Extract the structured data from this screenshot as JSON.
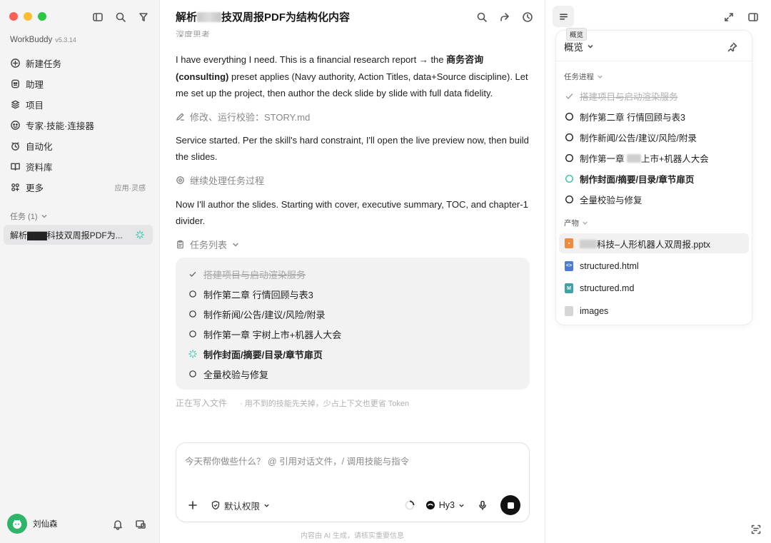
{
  "sidebar": {
    "brand": "WorkBuddy",
    "version": "v5.3.14",
    "nav": [
      {
        "label": "新建任务",
        "icon": "plus-circle-icon"
      },
      {
        "label": "助理",
        "icon": "assistant-icon"
      },
      {
        "label": "项目",
        "icon": "folder-icon"
      },
      {
        "label": "专家·技能·连接器",
        "icon": "expert-icon"
      },
      {
        "label": "自动化",
        "icon": "automation-icon"
      },
      {
        "label": "资料库",
        "icon": "book-icon"
      },
      {
        "label": "更多",
        "icon": "grid-icon",
        "right": "应用·灵感"
      }
    ],
    "tasks_section": "任务 (1)",
    "task_item": "解析▇▇▇科技双周报PDF为...",
    "user_name": "刘仙森"
  },
  "main": {
    "title_prefix": "解析",
    "title_suffix": "技双周报PDF为结构化内容",
    "cut_text": "深度思考",
    "para1_a": "I have everything I need. This is a financial research report → the ",
    "para1_b": "商务咨询 (consulting)",
    "para1_c": " preset applies (Navy authority, Action Titles, data+Source discipline). Let me set up the project, then author the deck slide by slide with full data fidelity.",
    "step1": "修改、运行校验：STORY.md",
    "para2": "Service started. Per the skill's hard constraint, I'll open the live preview now, then build the slides.",
    "step2": "继续处理任务过程",
    "para3": "Now I'll author the slides. Starting with cover, executive summary, TOC, and chapter-1 divider.",
    "step3": "任务列表",
    "tasks": [
      {
        "label": "搭建项目与启动渲染服务",
        "state": "done"
      },
      {
        "label": "制作第二章 行情回顾与表3",
        "state": "todo"
      },
      {
        "label": "制作新闻/公告/建议/风险/附录",
        "state": "todo"
      },
      {
        "label": "制作第一章 宇树上市+机器人大会",
        "state": "todo"
      },
      {
        "label": "制作封面/摘要/目录/章节扉页",
        "state": "active"
      },
      {
        "label": "全量校验与修复",
        "state": "todo"
      }
    ],
    "status": "正在写入文件",
    "status_tip": "· 用不到的技能先关掉，少占上下文也更省 Token",
    "composer_placeholder": "今天帮你做些什么？ @ 引用对话文件，/ 调用技能与指令",
    "permission": "默认权限",
    "model": "Hy3",
    "disclaimer": "内容由 AI 生成，请核实重要信息"
  },
  "right": {
    "tooltip": "概览",
    "overview": "概览",
    "progress_label": "任务进程",
    "progress": [
      {
        "label": "搭建项目与启动渲染服务",
        "state": "done"
      },
      {
        "label": "制作第二章 行情回顾与表3",
        "state": "todo"
      },
      {
        "label": "制作新闻/公告/建议/风险/附录",
        "state": "todo"
      },
      {
        "label_a": "制作第一章 ",
        "label_b": "上市+机器人大会",
        "state": "todo",
        "blur": true
      },
      {
        "label": "制作封面/摘要/目录/章节扉页",
        "state": "active"
      },
      {
        "label": "全量校验与修复",
        "state": "todo"
      }
    ],
    "artifacts_label": "产物",
    "artifacts": [
      {
        "name": "科技–人形机器人双周报.pptx",
        "type": "pptx",
        "color": "#f08a3c"
      },
      {
        "name": "structured.html",
        "type": "html",
        "color": "#4a7bd8"
      },
      {
        "name": "structured.md",
        "type": "md",
        "color": "#3fa3a8"
      },
      {
        "name": "images",
        "type": "folder",
        "color": "#cfcfd2"
      }
    ]
  },
  "colors": {
    "accent_green": "#2fb56a",
    "active_teal": "#2ec4a6"
  }
}
